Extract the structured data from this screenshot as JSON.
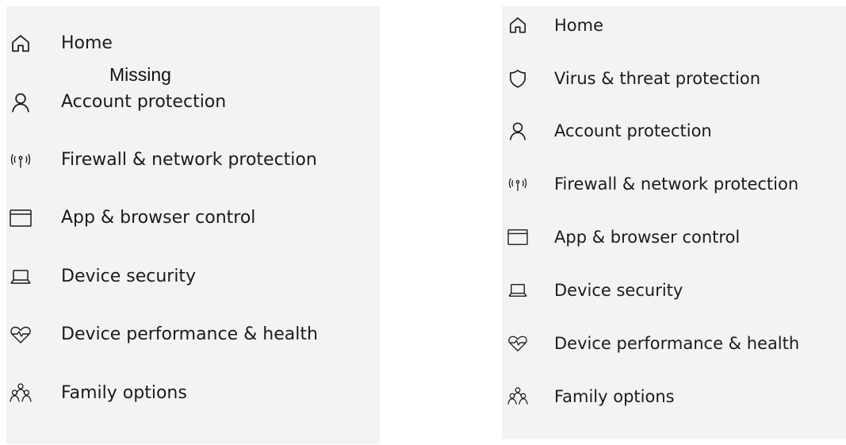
{
  "left_panel": {
    "annotation": "Missing",
    "items": [
      {
        "label": "Home",
        "icon": "home-icon"
      },
      {
        "label": "Account protection",
        "icon": "person-icon"
      },
      {
        "label": "Firewall & network protection",
        "icon": "antenna-icon"
      },
      {
        "label": "App & browser control",
        "icon": "app-window-icon"
      },
      {
        "label": "Device security",
        "icon": "laptop-icon"
      },
      {
        "label": "Device performance & health",
        "icon": "heart-pulse-icon"
      },
      {
        "label": "Family options",
        "icon": "family-icon"
      }
    ]
  },
  "right_panel": {
    "items": [
      {
        "label": "Home",
        "icon": "home-icon"
      },
      {
        "label": "Virus & threat protection",
        "icon": "shield-icon"
      },
      {
        "label": "Account protection",
        "icon": "person-icon"
      },
      {
        "label": "Firewall & network protection",
        "icon": "antenna-icon"
      },
      {
        "label": "App & browser control",
        "icon": "app-window-icon"
      },
      {
        "label": "Device security",
        "icon": "laptop-icon"
      },
      {
        "label": "Device performance & health",
        "icon": "heart-pulse-icon"
      },
      {
        "label": "Family options",
        "icon": "family-icon"
      }
    ]
  },
  "colors": {
    "panel_background": "#f3f3f3",
    "text": "#1b1b1b",
    "page_background": "#ffffff"
  }
}
